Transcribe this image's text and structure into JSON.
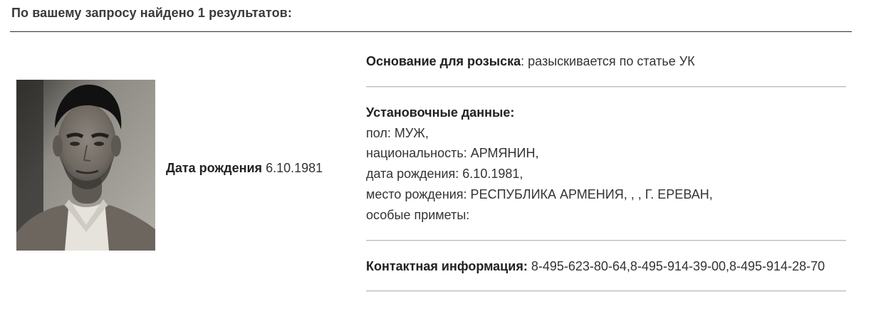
{
  "results": {
    "header": "По вашему запросу найдено 1 результатов:"
  },
  "person": {
    "photo_icon": "portrait-photo",
    "birth_label": "Дата рождения",
    "birth_value": "6.10.1981"
  },
  "details": {
    "reason": {
      "label": "Основание для розыска",
      "separator": ":",
      "value": " разыскивается по статье УК"
    },
    "identity": {
      "title": "Установочные данные:",
      "lines": [
        "пол: МУЖ,",
        "национальность: АРМЯНИН,",
        "дата рождения: 6.10.1981,",
        "место рождения: РЕСПУБЛИКА АРМЕНИЯ, , , Г. ЕРЕВАН,",
        "особые приметы:"
      ]
    },
    "contact": {
      "label": "Контактная информация:",
      "value": " 8-495-623-80-64,8-495-914-39-00,8-495-914-28-70"
    }
  },
  "colors": {
    "header_rule": "#2c2c2c",
    "section_rule": "#bdbdbd",
    "text": "#333333"
  }
}
